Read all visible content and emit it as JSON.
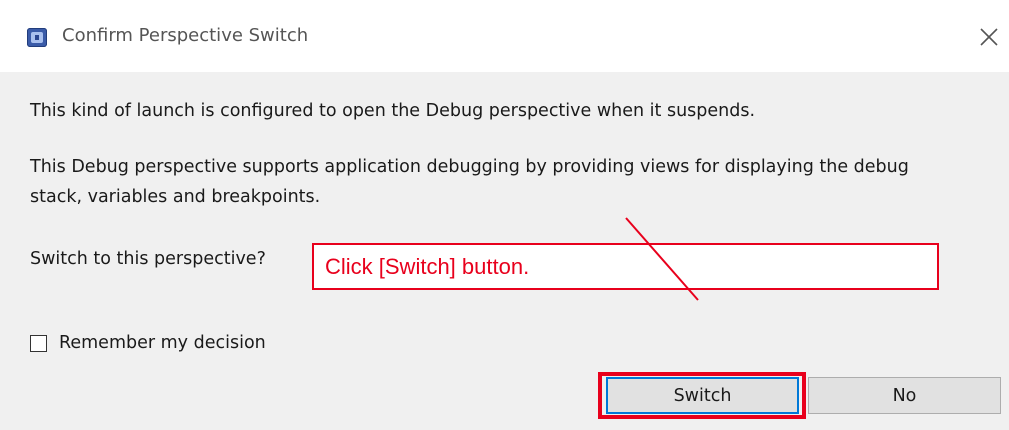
{
  "window": {
    "title": "Confirm Perspective Switch",
    "icon": "eclipse-app-icon",
    "close_icon": "close-icon"
  },
  "message": {
    "line1": "This kind of launch is configured to open the Debug perspective when it suspends.",
    "line2": "This Debug perspective supports application debugging by providing views for displaying the debug stack, variables and breakpoints.",
    "question": "Switch to this perspective?"
  },
  "remember": {
    "label": "Remember my decision",
    "checked": false
  },
  "buttons": {
    "switch_label": "Switch",
    "no_label": "No"
  },
  "annotation": {
    "callout_text": "Click [Switch] button.",
    "color": "#e8001c"
  },
  "colors": {
    "content_background": "#f0f0f0",
    "focus_border": "#0078d7",
    "button_background": "#e1e1e1"
  }
}
